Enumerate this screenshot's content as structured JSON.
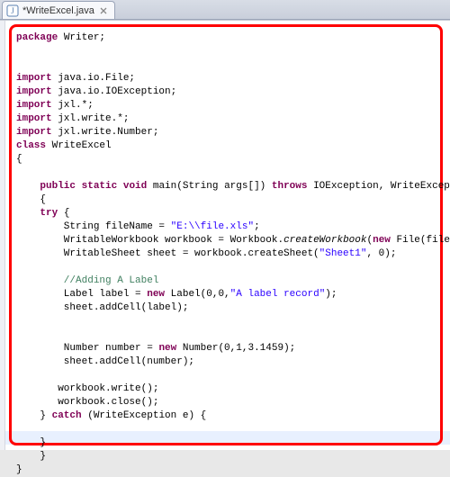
{
  "tab": {
    "title": "*WriteExcel.java",
    "icon": "java-file-icon",
    "close_tooltip": "Close"
  },
  "code": {
    "pkg_kw": "package",
    "pkg_name": " Writer;",
    "import_kw": "import",
    "imp1": " java.io.File;",
    "imp2": " java.io.IOException;",
    "imp3": " jxl.*;",
    "imp4": " jxl.write.*;",
    "imp5": " jxl.write.Number;",
    "class_kw": "class",
    "class_name": " WriteExcel",
    "lbrace": "{",
    "sig_pre": "    ",
    "kw_public": "public",
    "kw_static": "static",
    "kw_void": "void",
    "sig_mid": " main(String args[]) ",
    "kw_throws": "throws",
    "sig_post": " IOException, WriteException",
    "body_open": "    {",
    "try_ind": "    ",
    "kw_try": "try",
    "try_post": " {",
    "l_fn_pre": "        String fileName = ",
    "l_fn_str": "\"E:\\\\file.xls\"",
    "l_fn_post": ";",
    "l_wb_pre": "        WritableWorkbook workbook = Workbook.",
    "l_wb_ital": "createWorkbook",
    "l_wb_mid": "(",
    "kw_new": "new",
    "l_wb_post": " File(fileName));",
    "l_sh_pre": "        WritableSheet sheet = workbook.createSheet(",
    "l_sh_str": "\"Sheet1\"",
    "l_sh_post": ", 0);",
    "cmt1": "        //Adding A Label",
    "l_lbl_pre": "        Label label = ",
    "l_lbl_mid": " Label(0,0,",
    "l_lbl_str": "\"A label record\"",
    "l_lbl_post": ");",
    "l_addlbl": "        sheet.addCell(label);",
    "l_num_pre": "        Number number = ",
    "l_num_post": " Number(0,1,3.1459);",
    "l_addnum": "        sheet.addCell(number);",
    "l_write": "       workbook.write();",
    "l_close": "       workbook.close();",
    "catch_ind": "    } ",
    "kw_catch": "catch",
    "catch_post": " (WriteException e) {",
    "rb1": "    }",
    "rb2": "    }",
    "rb3": "}"
  },
  "colors": {
    "highlight_red": "#ff0000"
  }
}
